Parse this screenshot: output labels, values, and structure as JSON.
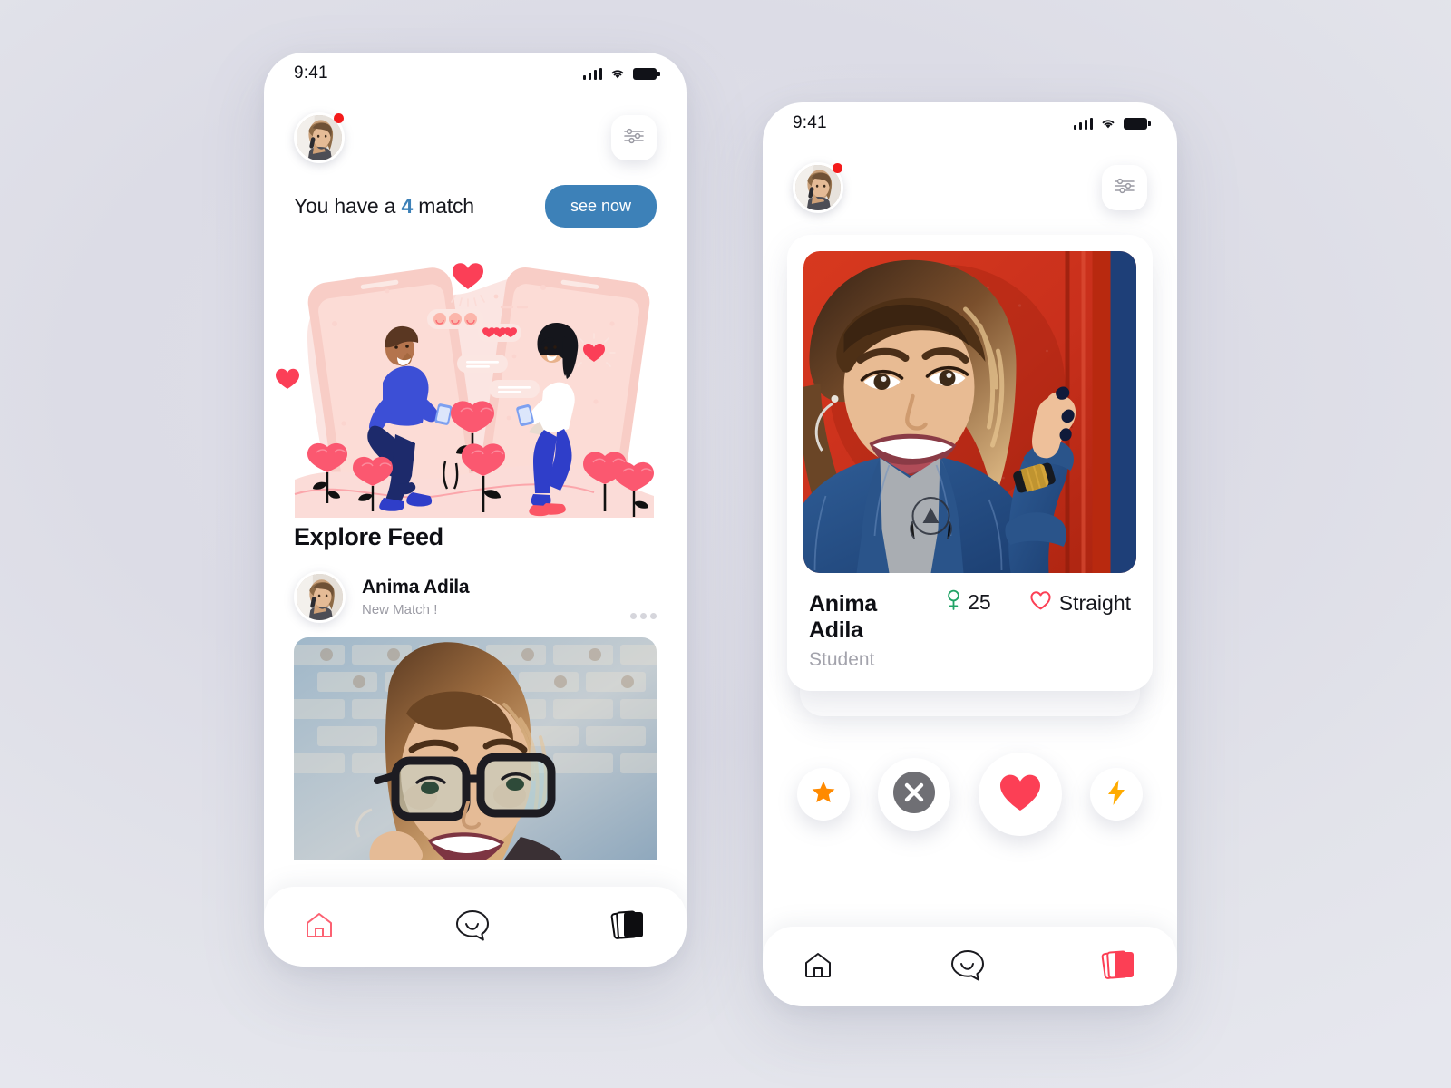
{
  "background_color": "#dcdce6",
  "phone_one": {
    "status_bar": {
      "time": "9:41",
      "icons": [
        "cellular-signal-icon",
        "wifi-icon",
        "battery-icon"
      ]
    },
    "header": {
      "avatar_name": "user-avatar",
      "has_notification_dot": true,
      "filter_icon": "sliders-filter-icon"
    },
    "match_banner": {
      "prefix": "You have a ",
      "count": "4",
      "suffix": " match",
      "count_color": "#3d81b8",
      "button_label": "see now",
      "button_color": "#3d81b8"
    },
    "illustration": {
      "name": "online-dating-couple-illustration",
      "accent_color": "#f8566d",
      "blob_color": "#fbe0dd"
    },
    "explore": {
      "title": "Explore Feed",
      "items": [
        {
          "name": "Anima Adila",
          "status": "New Match !",
          "avatar": "anima-avatar",
          "more_icon": "more-horizontal-icon",
          "photo": "woman-with-glasses-photo"
        }
      ]
    },
    "bottom_nav": [
      {
        "icon": "home-icon",
        "label": "Home",
        "active": true,
        "color": "#fc6172"
      },
      {
        "icon": "chat-bubble-icon",
        "label": "Chat",
        "active": false,
        "color": "#1a1a1f"
      },
      {
        "icon": "cards-stack-icon",
        "label": "Cards",
        "active": false,
        "color": "#0d0d10"
      }
    ]
  },
  "phone_two": {
    "status_bar": {
      "time": "9:41",
      "icons": [
        "cellular-signal-icon",
        "wifi-icon",
        "battery-icon"
      ]
    },
    "header": {
      "avatar_name": "user-avatar",
      "has_notification_dot": true,
      "filter_icon": "sliders-filter-icon"
    },
    "profile_card": {
      "photo": "anima-adila-portrait-red-wall",
      "name": "Anima Adila",
      "gender_icon": "female-symbol-icon",
      "gender_color": "#21a366",
      "age": "25",
      "orientation_icon": "heart-outline-icon",
      "orientation_color": "#fc3f55",
      "orientation": "Straight",
      "role": "Student"
    },
    "actions": [
      {
        "icon": "star-icon",
        "label": "Super Like",
        "color": "#ff8a00",
        "size": "small"
      },
      {
        "icon": "close-circle-icon",
        "label": "Dislike",
        "color": "#6f6f74",
        "size": "medium"
      },
      {
        "icon": "heart-filled-icon",
        "label": "Like",
        "color": "#fc3f55",
        "size": "large"
      },
      {
        "icon": "bolt-icon",
        "label": "Boost",
        "color": "#ffab00",
        "size": "small"
      }
    ],
    "bottom_nav": [
      {
        "icon": "home-icon",
        "label": "Home",
        "active": false,
        "color": "#1a1a1f"
      },
      {
        "icon": "chat-bubble-icon",
        "label": "Chat",
        "active": false,
        "color": "#1a1a1f"
      },
      {
        "icon": "cards-stack-icon",
        "label": "Cards",
        "active": true,
        "color": "#fc3f55"
      }
    ]
  }
}
